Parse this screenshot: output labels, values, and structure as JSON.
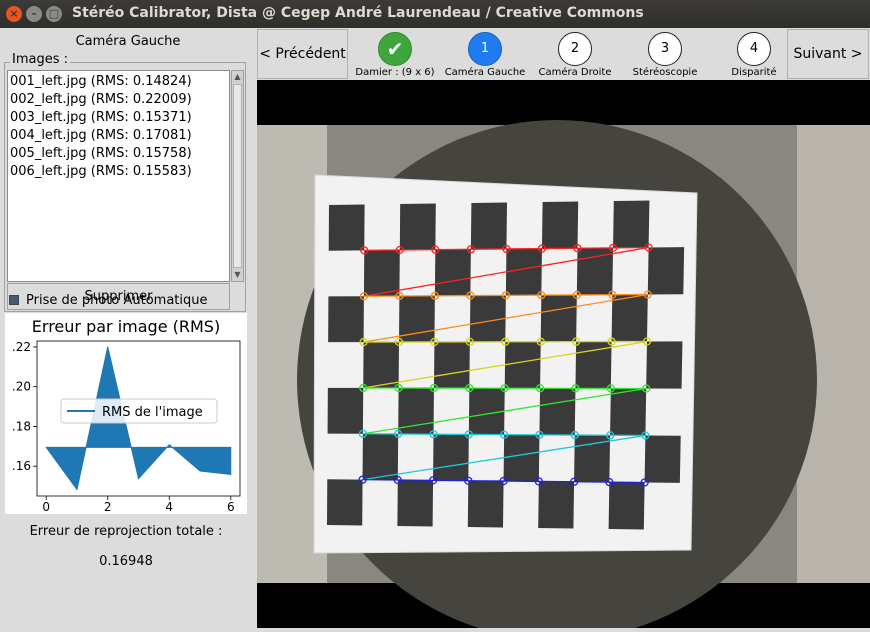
{
  "window": {
    "title": "Stéréo Calibrator, Dista @ Cegep André Laurendeau / Creative Commons",
    "close_glyph": "×",
    "min_glyph": "–",
    "max_glyph": "□"
  },
  "left": {
    "title": "Caméra Gauche",
    "group_label": "Images :",
    "images": [
      "001_left.jpg (RMS: 0.14824)",
      "002_left.jpg (RMS: 0.22009)",
      "003_left.jpg (RMS: 0.15371)",
      "004_left.jpg (RMS: 0.17081)",
      "005_left.jpg (RMS: 0.15758)",
      "006_left.jpg (RMS: 0.15583)"
    ],
    "delete_label": "Supprimer",
    "auto_capture_label": "Prise de photo Automatique",
    "auto_capture_checked": true,
    "total_error_label": "Erreur de reprojection totale :",
    "total_error_value": "0.16948"
  },
  "chart_data": {
    "type": "line",
    "title": "Erreur par image (RMS)",
    "series": [
      {
        "name": "RMS de l'image",
        "x": [
          0,
          1,
          2,
          3,
          4,
          5,
          6
        ],
        "values": [
          0.16948,
          0.14824,
          0.22009,
          0.15371,
          0.17081,
          0.15758,
          0.15583
        ],
        "color": "#1f77b4"
      }
    ],
    "baseline": 0.16948,
    "xlim": [
      -0.3,
      6.3
    ],
    "ylim": [
      0.145,
      0.223
    ],
    "xticks": [
      "0",
      "2",
      "4",
      "6"
    ],
    "xtick_values": [
      0,
      2,
      4,
      6
    ],
    "yticks": [
      ".16",
      ".18",
      ".20",
      ".22"
    ],
    "ytick_values": [
      0.16,
      0.18,
      0.2,
      0.22
    ],
    "grid": false,
    "legend": "center-right"
  },
  "toolbar": {
    "prev_label": "< Précédent",
    "next_label": "Suivant >",
    "steps": [
      {
        "label": "Damier : (9 x 6)",
        "symbol": "✔",
        "state": "done",
        "color": "#3ea63c"
      },
      {
        "label": "Caméra Gauche",
        "symbol": "1",
        "state": "active",
        "color": "#1e7cf0"
      },
      {
        "label": "Caméra Droite",
        "symbol": "2",
        "state": "pending",
        "color": "#ffffff"
      },
      {
        "label": "Stéréoscopie",
        "symbol": "3",
        "state": "pending",
        "color": "#ffffff"
      },
      {
        "label": "Disparité",
        "symbol": "4",
        "state": "pending",
        "color": "#ffffff"
      }
    ]
  },
  "photo": {
    "board_rows": 6,
    "board_cols": 9,
    "row_colors": [
      "#ff2020",
      "#ff8c1a",
      "#d6d61a",
      "#2ee82e",
      "#1ec8d8",
      "#2020d8"
    ]
  }
}
